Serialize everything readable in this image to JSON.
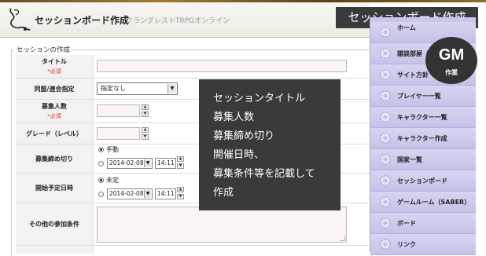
{
  "header": {
    "title": "セッションボード作成",
    "site_name": "クラングレストTRPGオンライン"
  },
  "overlay_title": "セッションボード作成",
  "form": {
    "legend": "セッションの作成",
    "required_text": "*必須",
    "fields": {
      "title": {
        "label": "タイトル"
      },
      "alliance": {
        "label": "同盟/連合指定",
        "selected": "指定なし"
      },
      "recruit_count": {
        "label": "募集人数"
      },
      "grade": {
        "label": "グレード（レベル）"
      },
      "deadline": {
        "label": "募集締め切り",
        "option_manual": "手動",
        "date": "2014-02-08",
        "time": "14:11"
      },
      "start_datetime": {
        "label": "開始予定日時",
        "option_undecided": "未定",
        "date": "2014-02-08",
        "time": "14:11"
      },
      "other_conditions": {
        "label": "その他の参加条件"
      }
    }
  },
  "tooltip": {
    "lines": [
      "セッションタイトル",
      "募集人数",
      "募集締め切り",
      "開催日時、",
      "募集条件等を記載して",
      "作成"
    ]
  },
  "sidebar": {
    "items": [
      {
        "label": "ホーム"
      },
      {
        "label": "雑談部屋（B"
      },
      {
        "label": "サイト方針"
      },
      {
        "label": "プレイヤー一覧"
      },
      {
        "label": "キャラクター一覧"
      },
      {
        "label": "キャラクター作成"
      },
      {
        "label": "国家一覧"
      },
      {
        "label": "セッションボード"
      },
      {
        "label": "ゲームルーム（SABER）"
      },
      {
        "label": "ボード"
      },
      {
        "label": "リンク"
      }
    ]
  },
  "gm_badge": {
    "main": "GM",
    "sub": "作業"
  },
  "colors": {
    "sidebar_bg": "#c9c6ea",
    "required": "#d4342b",
    "overlay_bg": "#3a3a3a",
    "input_bg": "#fbf4f4"
  },
  "icons": {
    "sidebar_icon": "snowflake-icon",
    "header_logo": "flourish-logo-icon"
  }
}
